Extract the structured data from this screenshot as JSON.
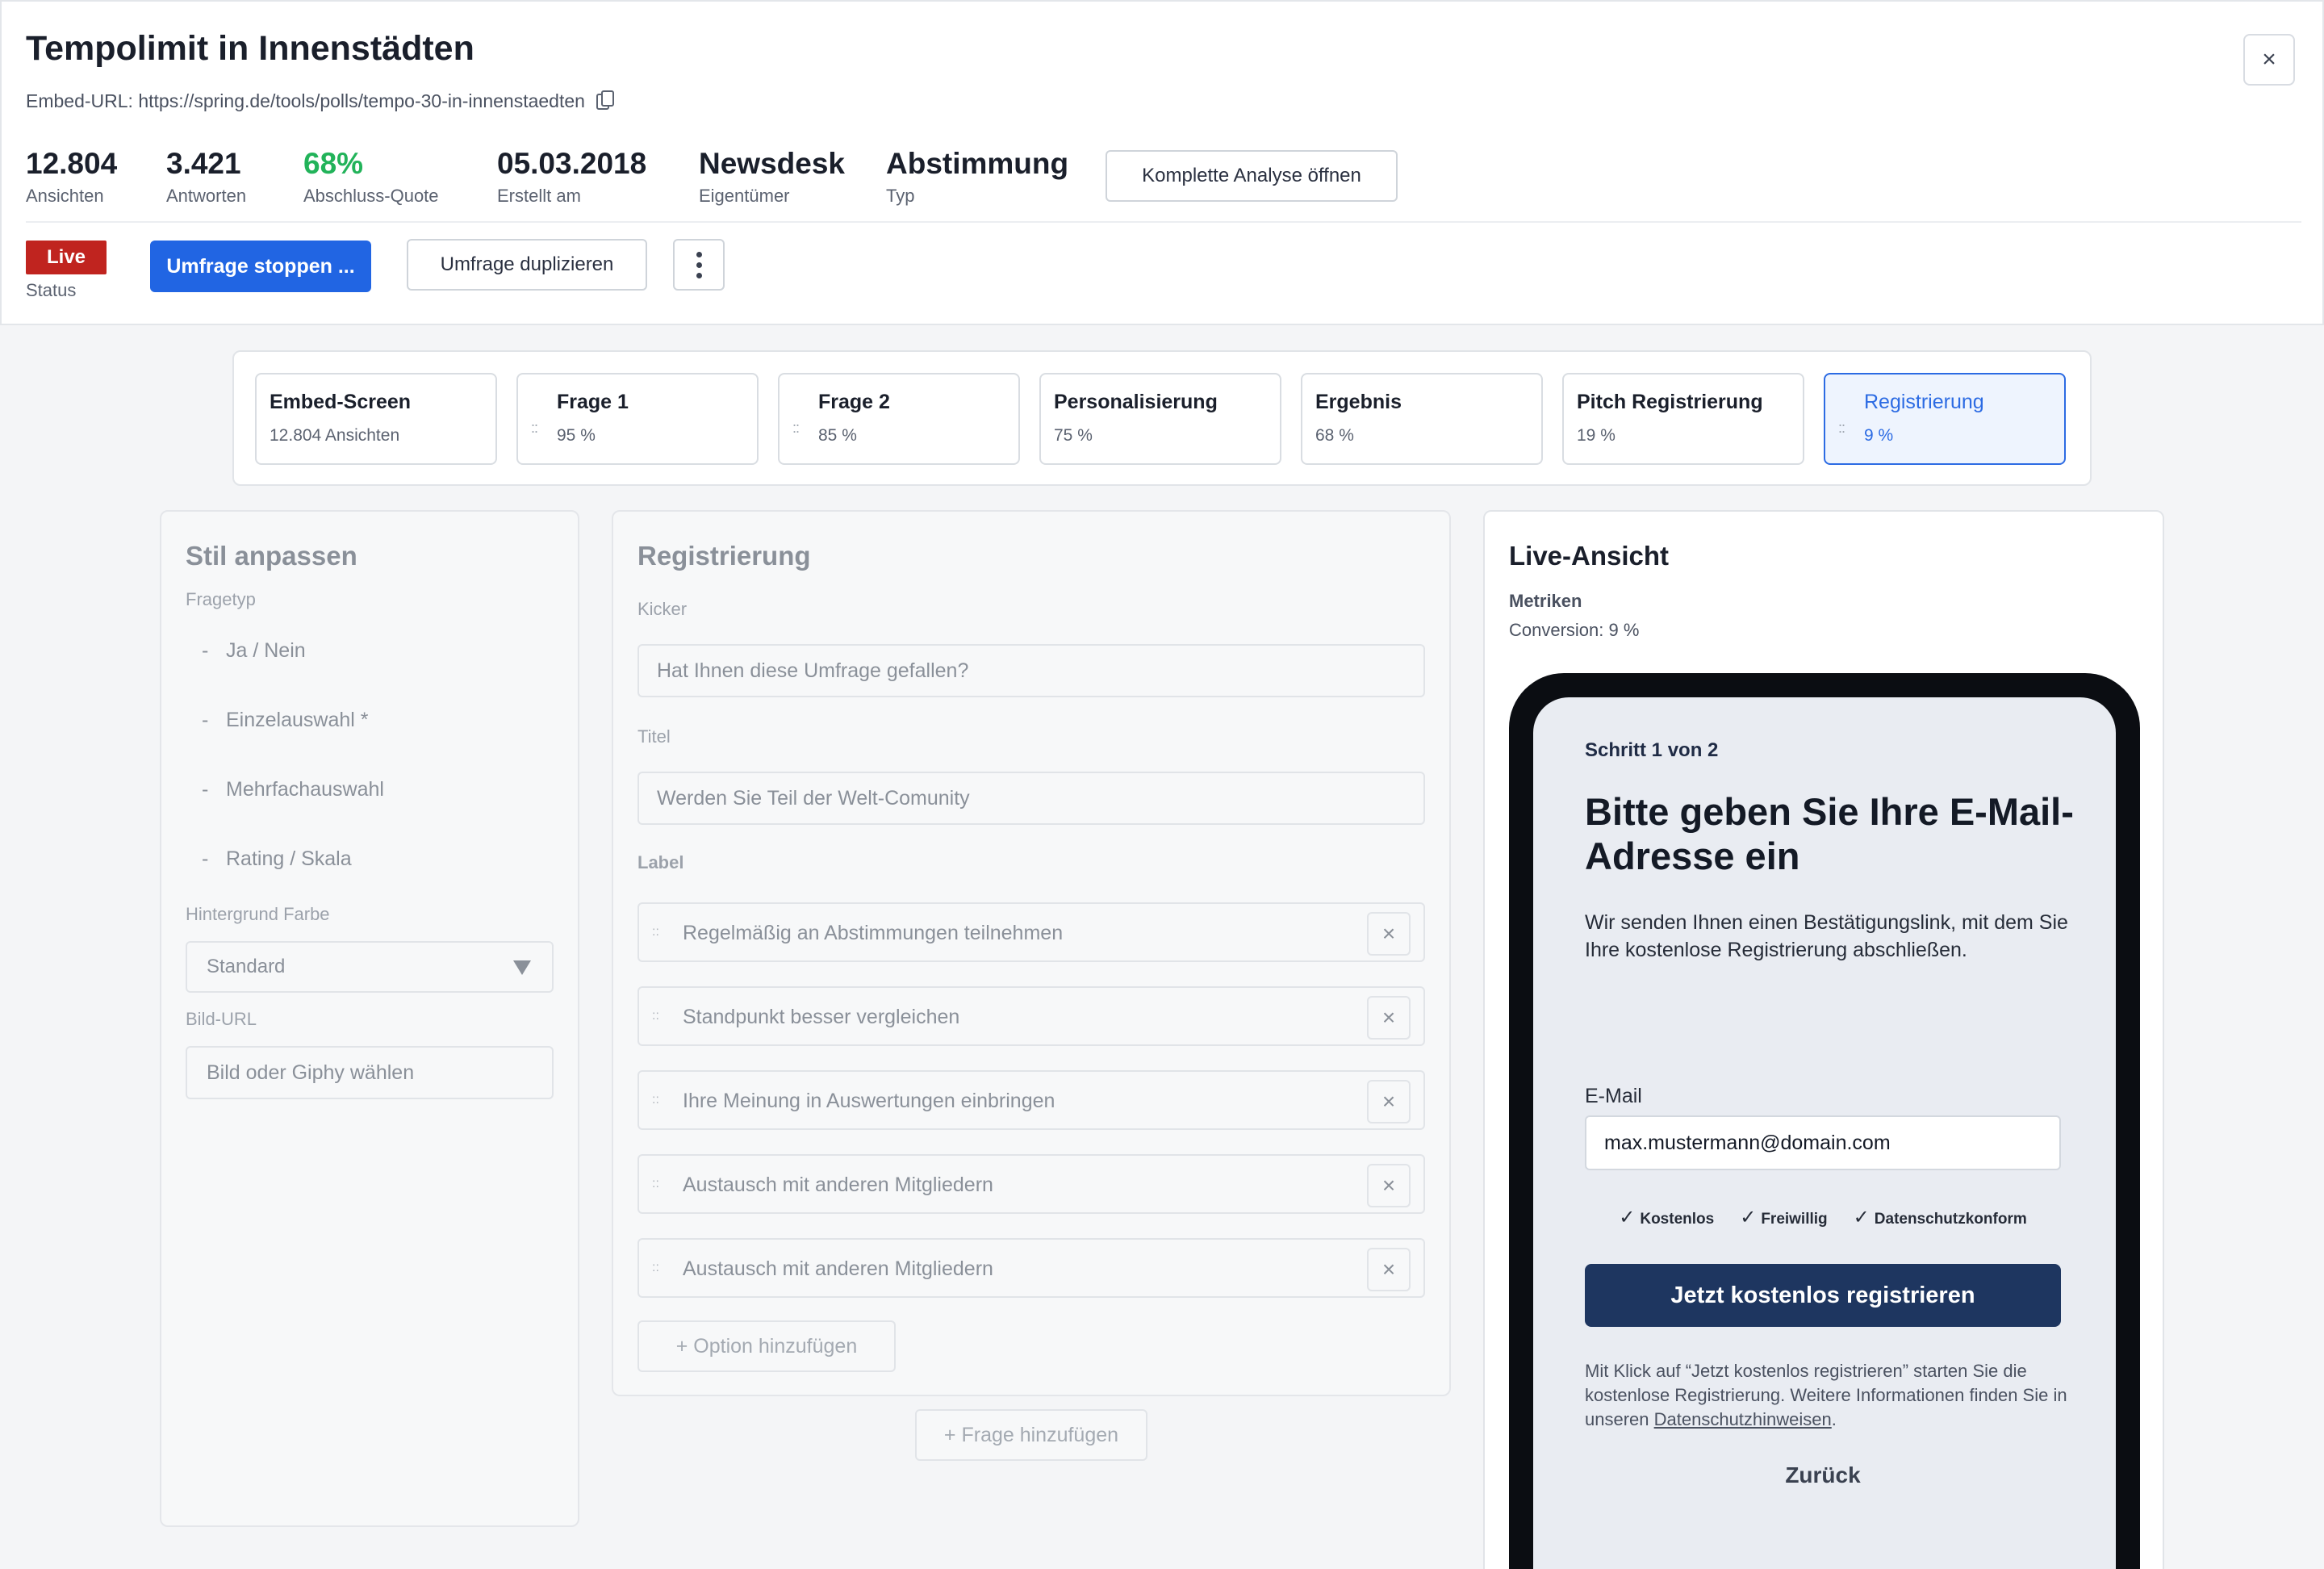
{
  "header": {
    "title": "Tempolimit in Innenstädten",
    "embed_url": "Embed-URL: https://spring.de/tools/polls/tempo-30-in-innenstaedten",
    "stats": [
      {
        "value": "12.804",
        "label": "Ansichten"
      },
      {
        "value": "3.421",
        "label": "Antworten"
      },
      {
        "value": "68%",
        "label": "Abschluss-Quote"
      },
      {
        "value": "05.03.2018",
        "label": "Erstellt am"
      },
      {
        "value": "Newsdesk",
        "label": "Eigentümer"
      },
      {
        "value": "Abstimmung",
        "label": "Typ"
      }
    ],
    "analyse_button": "Komplette Analyse öffnen",
    "status_badge": "Live",
    "status_label": "Status",
    "stop_button": "Umfrage stoppen ...",
    "duplicate_button": "Umfrage duplizieren",
    "close_icon": "×",
    "accent_color": "#2165e3",
    "live_color": "#c0241f",
    "quote_color": "#22b35a"
  },
  "steps": [
    {
      "title": "Embed-Screen",
      "sub": "12.804 Ansichten"
    },
    {
      "title": "Frage 1",
      "sub": "95 %"
    },
    {
      "title": "Frage 2",
      "sub": "85 %"
    },
    {
      "title": "Personalisierung",
      "sub": "75 %"
    },
    {
      "title": "Ergebnis",
      "sub": "68 %"
    },
    {
      "title": "Pitch Registrierung",
      "sub": "19 %"
    },
    {
      "title": "Registrierung",
      "sub": "9 %",
      "active": true
    }
  ],
  "style_panel": {
    "title": "Stil anpassen",
    "question_type_label": "Fragetyp",
    "question_types": [
      "Ja / Nein",
      "Einzelauswahl *",
      "Mehrfachauswahl",
      "Rating / Skala"
    ],
    "background_label": "Hintergrund Farbe",
    "background_value": "Standard",
    "image_label": "Bild-URL",
    "image_placeholder": "Bild oder Giphy wählen"
  },
  "registration_panel": {
    "title": "Registrierung",
    "kicker_label": "Kicker",
    "kicker_value": "Hat Ihnen diese Umfrage gefallen?",
    "title_label": "Titel",
    "title_value": "Werden Sie Teil der Welt-Comunity",
    "label_label": "Label",
    "options": [
      "Regelmäßig an Abstimmungen teilnehmen",
      "Standpunkt besser vergleichen",
      "Ihre Meinung in Auswertungen einbringen",
      "Austausch mit anderen Mitgliedern",
      "Austausch mit anderen Mitgliedern"
    ],
    "add_option": "+ Option hinzufügen",
    "add_question": "+ Frage hinzufügen"
  },
  "live_view": {
    "title": "Live-Ansicht",
    "metrics_label": "Metriken",
    "conversion": "Conversion: 9 %",
    "phone": {
      "step": "Schritt 1 von 2",
      "headline": "Bitte geben Sie Ihre E-Mail-Adresse ein",
      "description": "Wir senden Ihnen einen Bestätigungslink, mit dem Sie Ihre kostenlose Registrierung abschließen.",
      "email_label": "E-Mail",
      "email_value": "max.mustermann@domain.com",
      "checks": [
        "Kostenlos",
        "Freiwillig",
        "Datenschutzkonform"
      ],
      "cta": "Jetzt kostenlos registrieren",
      "fine_print": "Mit Klick auf “Jetzt kostenlos registrieren” starten Sie die kostenlose Registrierung. Weitere Informationen finden Sie in unseren ",
      "fine_link": "Datenschutzhinweisen",
      "fine_end": ".",
      "back": "Zurück",
      "cta_color": "#1e3660"
    }
  }
}
